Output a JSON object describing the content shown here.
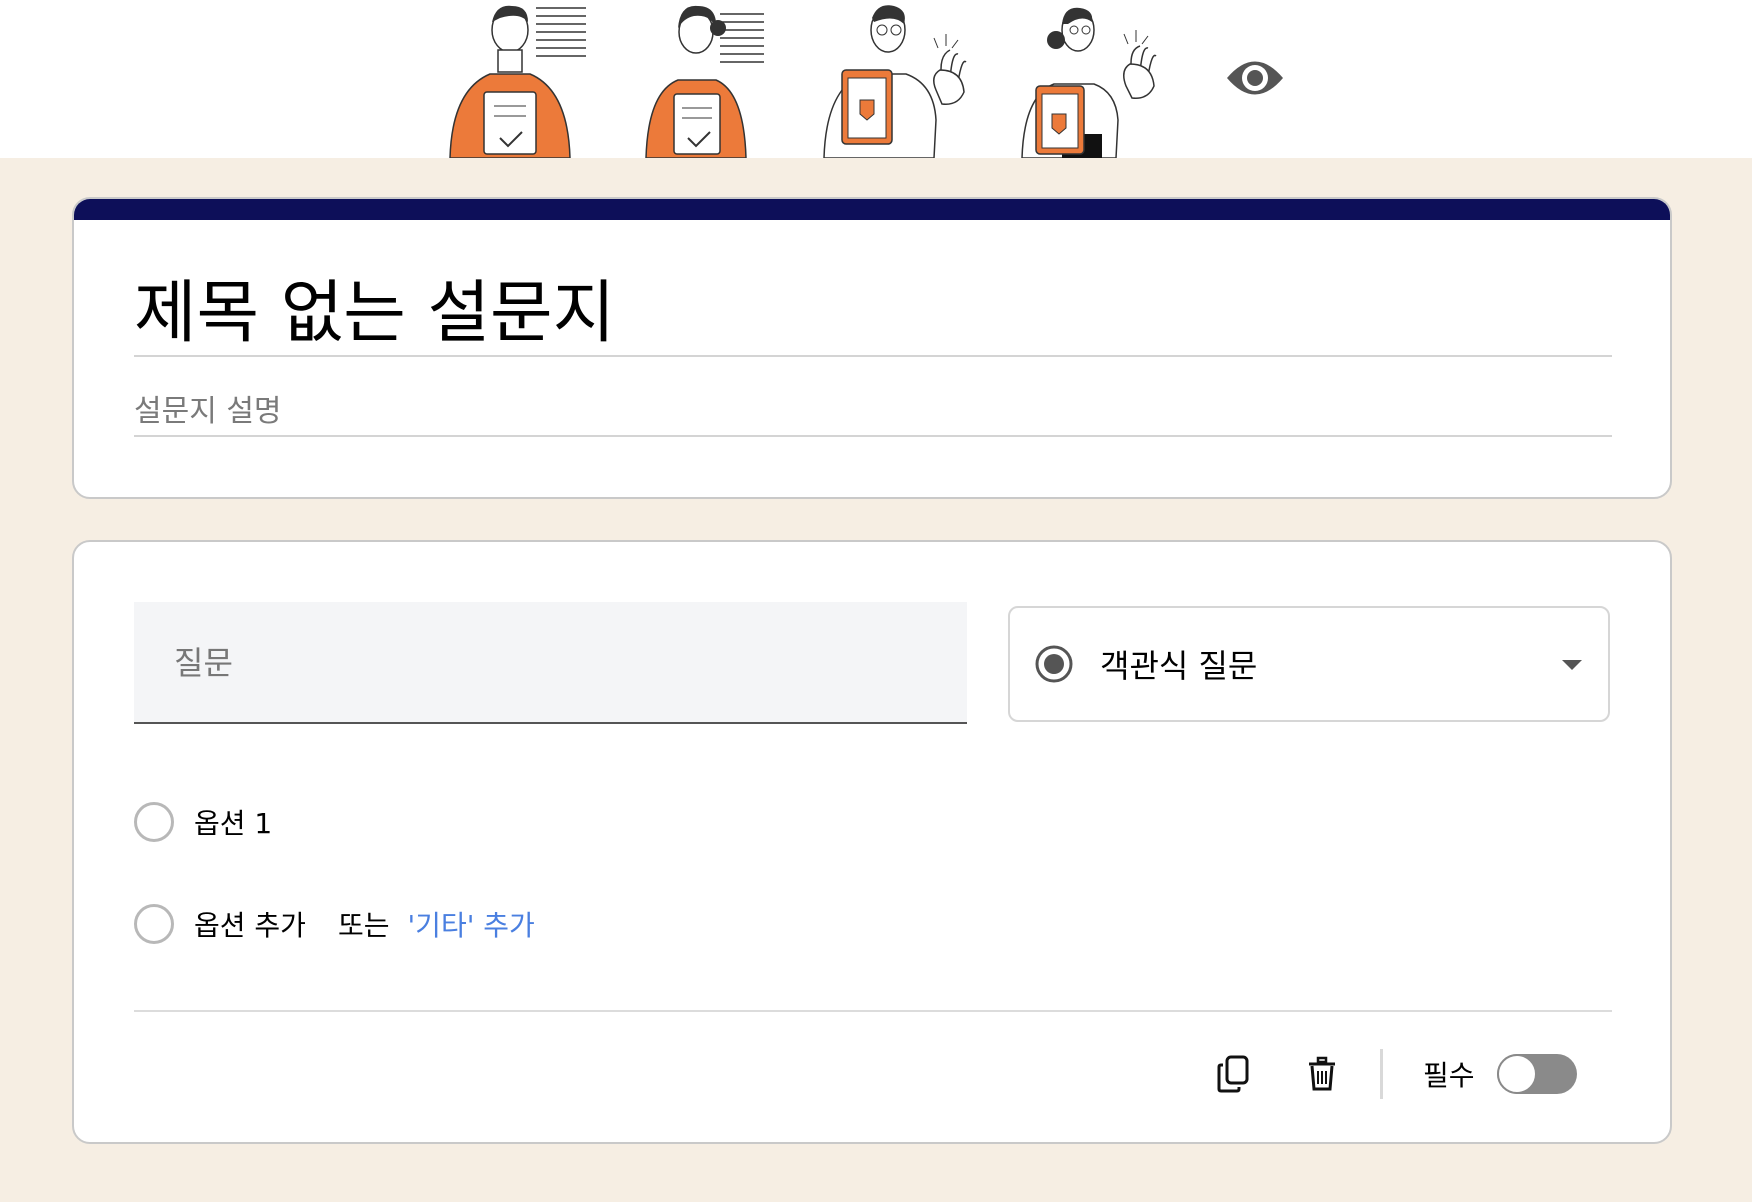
{
  "header": {
    "illustrations": [
      "person-with-checklist-illustration",
      "woman-with-checklist-illustration",
      "doctor-with-clipboard-illustration",
      "woman-with-clipboard-illustration"
    ],
    "preview_icon": "eye-icon"
  },
  "colors": {
    "page_background": "#f6eee3",
    "title_card_accent": "#0d0f59",
    "link": "#4a7fe0",
    "illustration_accent": "#ec7a3a"
  },
  "form": {
    "title": "제목 없는 설문지",
    "description_placeholder": "설문지 설명"
  },
  "question": {
    "title_placeholder": "질문",
    "type_label": "객관식 질문",
    "option_1": "옵션 1",
    "add_option": "옵션 추가",
    "or": "또는",
    "add_other": "'기타' 추가",
    "required_label": "필수",
    "required_on": false
  }
}
